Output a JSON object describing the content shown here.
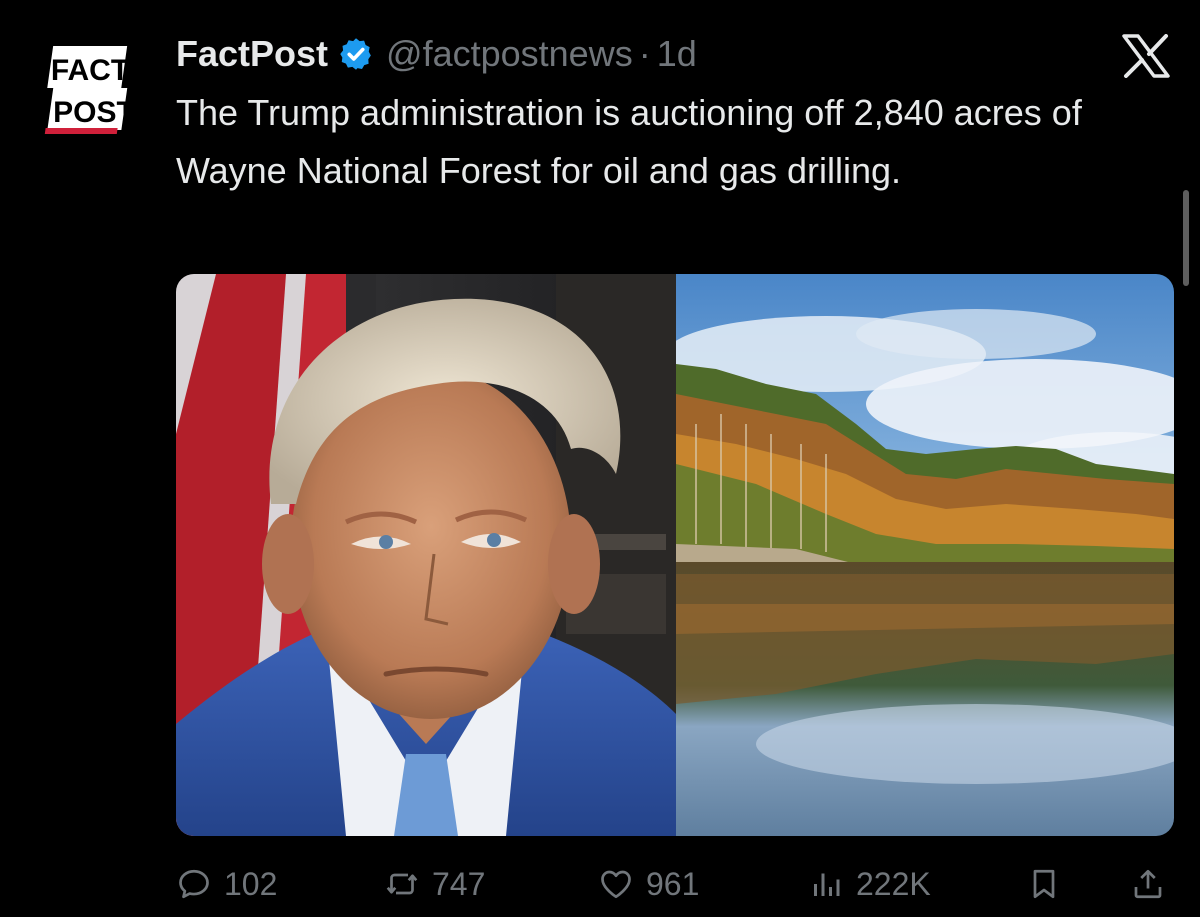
{
  "account": {
    "logo_text_line1": "FACT",
    "logo_text_line2": "POST",
    "display_name": "FactPost",
    "handle": "@factpostnews",
    "separator": "·",
    "time": "1d",
    "verified": true
  },
  "tweet": {
    "text": "The Trump administration is auctioning off 2,840 acres of Wayne National Forest for oil and gas drilling."
  },
  "media": {
    "left_image_icon": "portrait-photo",
    "right_image_icon": "forest-lake-photo"
  },
  "actions": {
    "replies": "102",
    "reposts": "747",
    "likes": "961",
    "views": "222K"
  },
  "colors": {
    "background": "#000000",
    "text": "#e7e9ea",
    "muted": "#71767b",
    "verified_blue": "#1d9bf0"
  }
}
